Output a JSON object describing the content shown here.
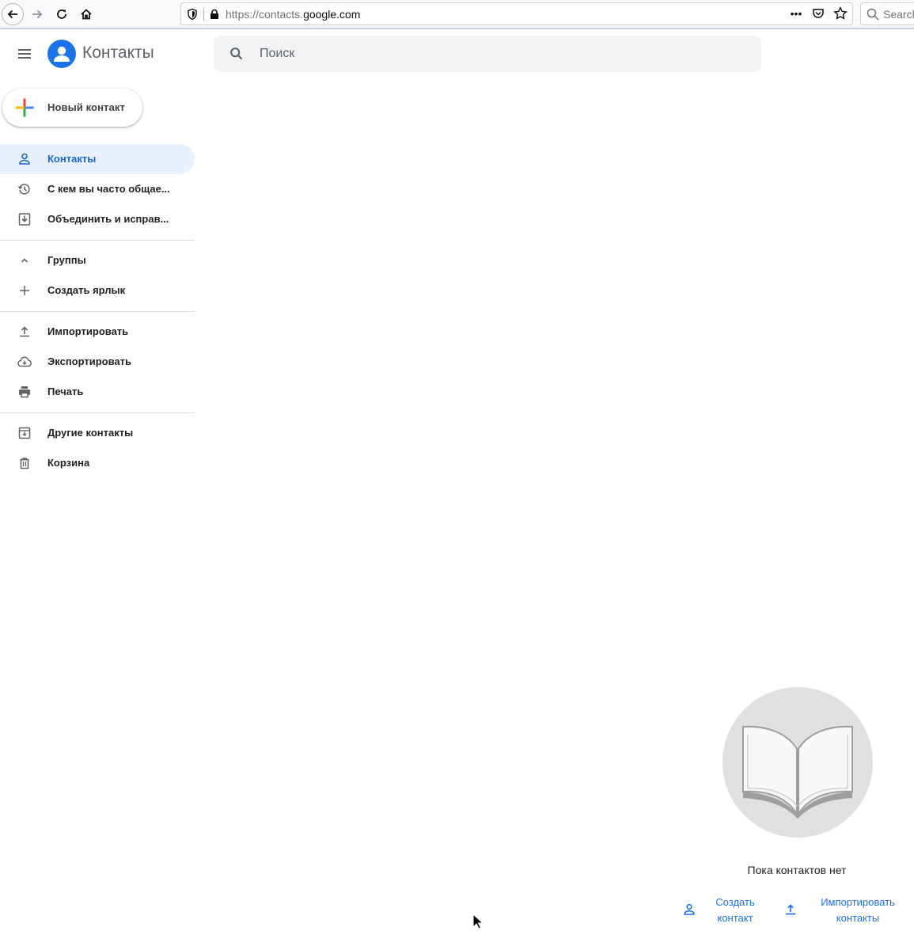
{
  "browser": {
    "url_prefix": "https://contacts.",
    "url_domain": "google.com",
    "search_placeholder": "Search"
  },
  "app": {
    "title": "Контакты",
    "search_placeholder": "Поиск",
    "new_contact_label": "Новый контакт"
  },
  "sidebar": {
    "items": [
      {
        "label": "Контакты",
        "icon": "person-icon"
      },
      {
        "label": "С кем вы часто общае...",
        "icon": "history-icon"
      },
      {
        "label": "Объединить и исправ...",
        "icon": "merge-icon"
      },
      {
        "label": "Группы",
        "icon": "chevron-up-icon"
      },
      {
        "label": "Создать ярлык",
        "icon": "plus-icon"
      },
      {
        "label": "Импортировать",
        "icon": "upload-icon"
      },
      {
        "label": "Экспортировать",
        "icon": "cloud-download-icon"
      },
      {
        "label": "Печать",
        "icon": "printer-icon"
      },
      {
        "label": "Другие контакты",
        "icon": "archive-icon"
      },
      {
        "label": "Корзина",
        "icon": "trash-icon"
      }
    ]
  },
  "empty_state": {
    "message": "Пока контактов нет",
    "create_line1": "Создать",
    "create_line2": "контакт",
    "import_line1": "Импортировать",
    "import_line2": "контакты",
    "illustration": "open-book-icon"
  },
  "colors": {
    "accent": "#1a73e8",
    "active_bg": "#e8f0fe",
    "search_bg": "#f1f3f4"
  }
}
